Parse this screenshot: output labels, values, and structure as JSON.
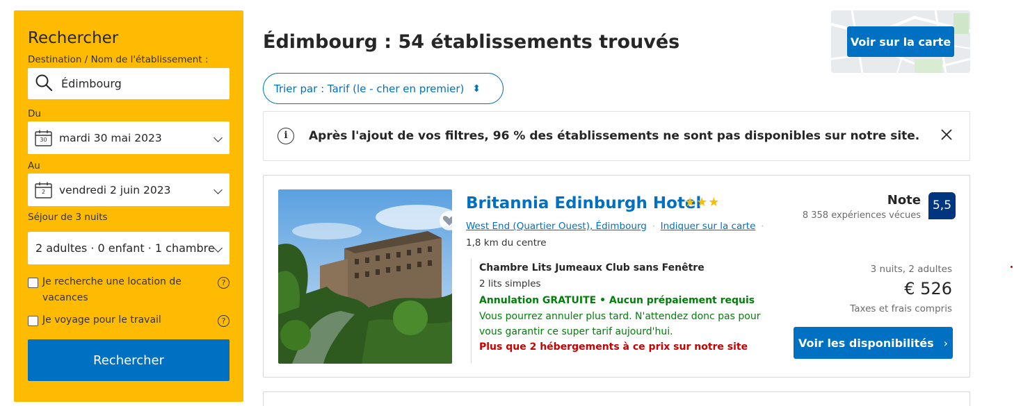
{
  "sidebar": {
    "title": "Rechercher",
    "destination_label": "Destination / Nom de l'établissement :",
    "destination_value": "Édimbourg",
    "checkin_label": "Du",
    "checkin_value": "mardi 30 mai 2023",
    "checkin_day": "30",
    "checkout_label": "Au",
    "checkout_value": "vendredi 2 juin 2023",
    "checkout_day": "2",
    "stay_length": "Séjour de 3 nuits",
    "guests_value": "2 adultes · 0 enfant · 1 chambre",
    "vacation_rental_label": "Je recherche une location de vacances",
    "business_travel_label": "Je voyage pour le travail",
    "help_glyph": "?",
    "search_button": "Rechercher"
  },
  "results": {
    "title": "Édimbourg : 54 établissements trouvés",
    "map_button": "Voir sur la carte",
    "sort_label": "Trier par : Tarif (le - cher en premier)",
    "sort_glyph": "⬍",
    "alert_text": "Après l'ajout de vos filtres, 96 % des établissements ne sont pas disponibles sur notre site.",
    "info_glyph": "i"
  },
  "hotel": {
    "name": "Britannia Edinburgh Hotel",
    "stars": "★★★",
    "location": "West End (Quartier Ouest), Édimbourg",
    "map_link": "Indiquer sur la carte",
    "separator": "·",
    "distance": "1,8 km du centre",
    "score_label": "Note",
    "reviews": "8 358 expériences vécues",
    "score": "5,5",
    "room_name": "Chambre Lits Jumeaux Club sans Fenêtre",
    "beds": "2 lits simples",
    "cancellation": "Annulation GRATUITE • Aucun prépaiement requis",
    "cancellation_desc": "Vous pourrez annuler plus tard. N'attendez donc pas pour vous garantir ce super tarif aujourd'hui.",
    "scarcity": "Plus que 2 hébergements à ce prix sur notre site",
    "stay_info": "3 nuits, 2 adultes",
    "price": "€ 526",
    "taxes": "Taxes et frais compris",
    "availability_button": "Voir les disponibilités",
    "button_arrow": "›"
  },
  "colors": {
    "brand_yellow": "#febb02",
    "brand_blue": "#0071c2",
    "score_blue": "#003580",
    "green": "#008009",
    "red": "#cc0000"
  }
}
